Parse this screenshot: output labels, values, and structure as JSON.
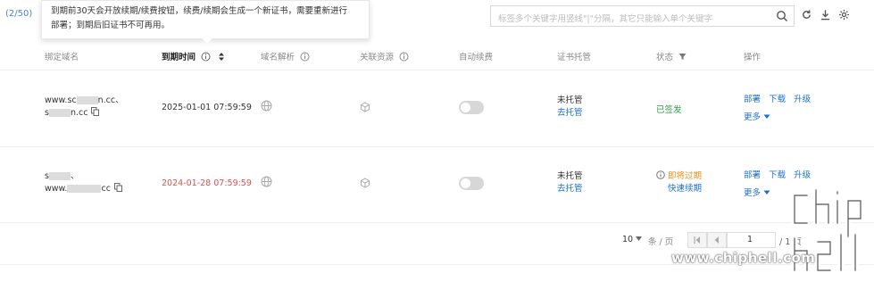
{
  "toolbar": {
    "count": "(2/50)",
    "search_placeholder": "标签多个关键字用竖线\"|\"分隔，其它只能输入单个关键字"
  },
  "tooltip": {
    "line1": "到期前30天会开放续期/续费按钮，续费/续期会生成一个新证书，需要重新进行",
    "line2": "部署；到期后旧证书不可再用。"
  },
  "columns": {
    "domain": "绑定域名",
    "expiry": "到期时间",
    "dns": "域名解析",
    "resource": "关联资源",
    "auto_renew": "自动续费",
    "hosting": "证书托管",
    "status": "状态",
    "actions": "操作"
  },
  "rows": [
    {
      "domain_line1_pre": "www.sc",
      "domain_line1_post": "n.cc、",
      "domain_line2_pre": "s",
      "domain_line2_post": "n.cc",
      "expiry": "2025-01-01 07:59:59",
      "hosting": "未托管",
      "hosting_link": "去托管",
      "status": "已签发",
      "deploy": "部署",
      "download": "下载",
      "upgrade": "升级",
      "more": "更多"
    },
    {
      "domain_line1_pre": "s",
      "domain_line1_post": "、",
      "domain_line2_pre": "www.",
      "domain_line2_post": "cc",
      "expiry": "2024-01-28 07:59:59",
      "hosting": "未托管",
      "hosting_link": "去托管",
      "status": "即将过期",
      "status_link": "快速续期",
      "deploy": "部署",
      "download": "下载",
      "upgrade": "升级",
      "more": "更多"
    }
  ],
  "pager": {
    "page_size": "10",
    "per_page_label": "条 / 页",
    "current_page": "1",
    "total": "/ 1 页"
  },
  "watermark": {
    "text": "www.chiphell.com"
  },
  "colors": {
    "link": "#1a6fd0",
    "issued": "#2ea043",
    "expiring": "#e58e1a",
    "expired_date": "#d9534f"
  }
}
